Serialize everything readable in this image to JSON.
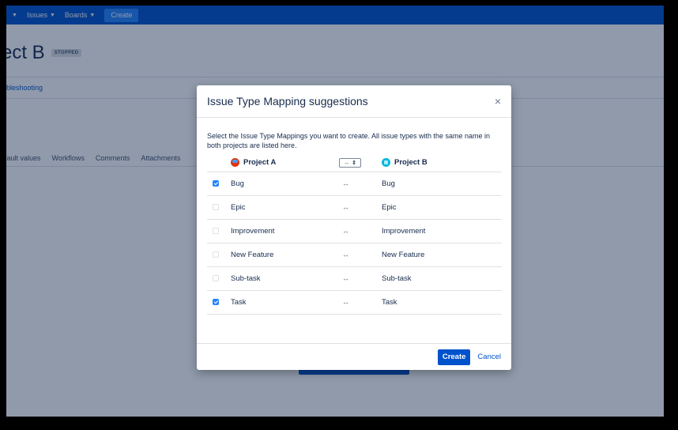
{
  "nav": {
    "items": [
      {
        "label": "Issues"
      },
      {
        "label": "Boards"
      }
    ],
    "create_label": "Create"
  },
  "page": {
    "title": "ect B",
    "status": "STOPPED",
    "subnav_link": "bleshooting",
    "tabs": [
      "fault values",
      "Workflows",
      "Comments",
      "Attachments"
    ]
  },
  "modal": {
    "title": "Issue Type Mapping suggestions",
    "description": "Select the Issue Type Mappings you want to create. All issue types with the same name in both projects are listed here.",
    "project_a": "Project A",
    "project_b": "Project B",
    "swap_arrows": "↔",
    "swap_updown": "⇕",
    "rows": [
      {
        "a": "Bug",
        "arrow": "↔",
        "b": "Bug",
        "checked": true
      },
      {
        "a": "Epic",
        "arrow": "↔",
        "b": "Epic",
        "checked": false
      },
      {
        "a": "Improvement",
        "arrow": "↔",
        "b": "Improvement",
        "checked": false
      },
      {
        "a": "New Feature",
        "arrow": "↔",
        "b": "New Feature",
        "checked": false
      },
      {
        "a": "Sub-task",
        "arrow": "↔",
        "b": "Sub-task",
        "checked": false
      },
      {
        "a": "Task",
        "arrow": "↔",
        "b": "Task",
        "checked": true
      }
    ],
    "create_label": "Create",
    "cancel_label": "Cancel",
    "close_glyph": "×"
  },
  "colors": {
    "nav_bg": "#0052cc",
    "primary": "#0052cc",
    "checkbox_checked": "#2684ff"
  }
}
